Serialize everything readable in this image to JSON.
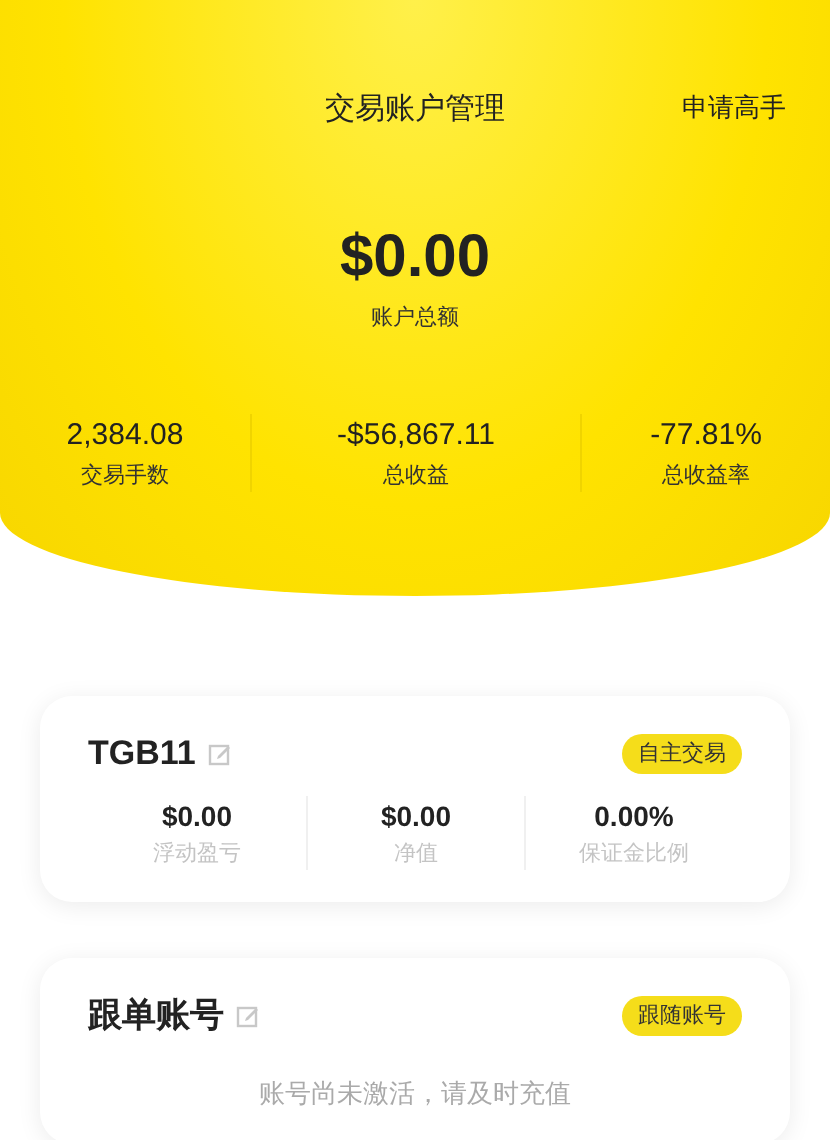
{
  "header": {
    "title": "交易账户管理",
    "action": "申请高手",
    "balance": "$0.00",
    "balance_label": "账户总额",
    "stats": [
      {
        "value": "2,384.08",
        "label": "交易手数"
      },
      {
        "value": "-$56,867.11",
        "label": "总收益"
      },
      {
        "value": "-77.81%",
        "label": "总收益率"
      }
    ]
  },
  "accounts": [
    {
      "kind": "active",
      "name": "TGB11",
      "tag": "自主交易",
      "metrics": [
        {
          "value": "$0.00",
          "label": "浮动盈亏"
        },
        {
          "value": "$0.00",
          "label": "净值"
        },
        {
          "value": "0.00%",
          "label": "保证金比例"
        }
      ]
    },
    {
      "kind": "inactive",
      "name": "跟单账号",
      "tag": "跟随账号",
      "notice": "账号尚未激活，请及时充值"
    }
  ]
}
